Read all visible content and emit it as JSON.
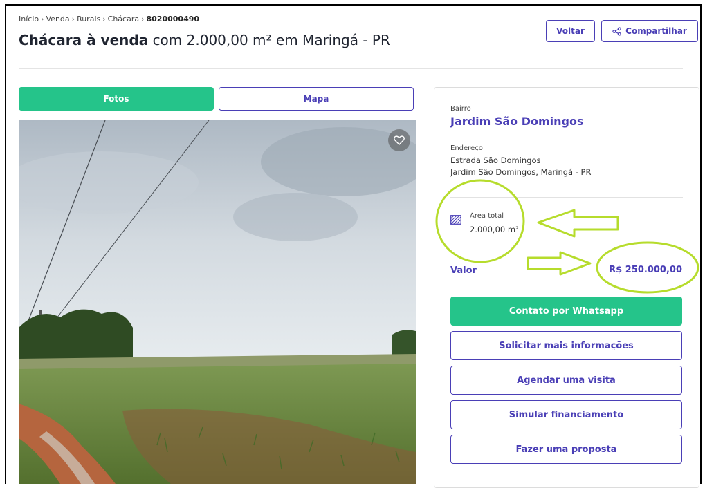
{
  "breadcrumb": {
    "items": [
      "Início",
      "Venda",
      "Rurais",
      "Chácara"
    ],
    "code": "8020000490"
  },
  "title": {
    "bold": "Chácara à venda",
    "rest": "com 2.000,00 m² em Maringá - PR"
  },
  "header_buttons": {
    "back": "Voltar",
    "share": "Compartilhar"
  },
  "tabs": {
    "photos": "Fotos",
    "map": "Mapa"
  },
  "info": {
    "bairro_label": "Bairro",
    "bairro": "Jardim São Domingos",
    "address_label": "Endereço",
    "address_line1": "Estrada São Domingos",
    "address_line2": "Jardim São Domingos, Maringá - PR",
    "area_label": "Área total",
    "area_value": "2.000,00 m²",
    "price_label": "Valor",
    "price": "R$ 250.000,00"
  },
  "actions": {
    "whatsapp": "Contato por Whatsapp",
    "more_info": "Solicitar mais informações",
    "visit": "Agendar uma visita",
    "financing": "Simular financiamento",
    "proposal": "Fazer uma proposta"
  },
  "icons": {
    "favorite": "heart-icon",
    "share": "share-icon",
    "area": "area-icon"
  },
  "colors": {
    "brand": "#4a3fb6",
    "accent": "#25c48a",
    "annotation": "#b6dc2c"
  }
}
